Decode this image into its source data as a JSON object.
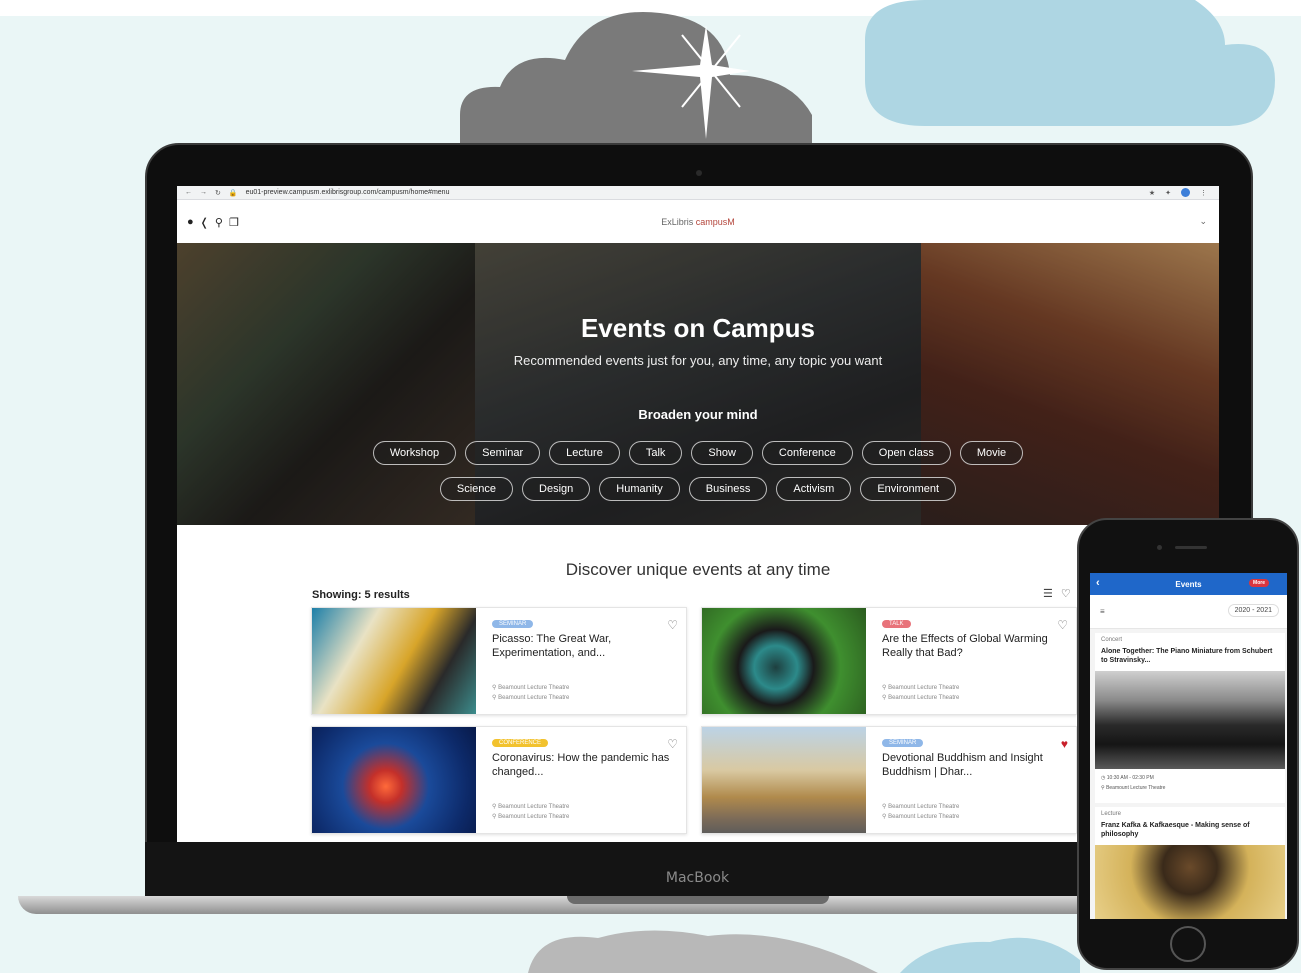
{
  "device": {
    "laptop_brand": "MacBook"
  },
  "browser": {
    "url": "eu01-preview.campusm.exlibrisgroup.com/campusm/home#menu"
  },
  "app": {
    "logo_prefix": "ExLibris",
    "logo_name": "campusM"
  },
  "hero": {
    "title": "Events on Campus",
    "subtitle": "Recommended events just for you, any time, any topic you want",
    "broaden": "Broaden your mind",
    "chips_row1": [
      "Workshop",
      "Seminar",
      "Lecture",
      "Talk",
      "Show",
      "Conference",
      "Open class",
      "Movie"
    ],
    "chips_row2": [
      "Science",
      "Design",
      "Humanity",
      "Business",
      "Activism",
      "Environment"
    ]
  },
  "discover": {
    "heading": "Discover unique events at any time",
    "showing": "Showing: 5 results"
  },
  "events": [
    {
      "badge": "Seminar",
      "badge_color": "#8fb7e8",
      "title": "Picasso: The Great War, Experimentation, and...",
      "loc1": "Beamount Lecture Theatre",
      "loc2": "Beamount Lecture Theatre",
      "favorited": false
    },
    {
      "badge": "Talk",
      "badge_color": "#e8737a",
      "title": "Are the Effects of Global Warming Really that Bad?",
      "loc1": "Beamount Lecture Theatre",
      "loc2": "Beamount Lecture Theatre",
      "favorited": false
    },
    {
      "badge": "Conference",
      "badge_color": "#f2c22e",
      "title": "Coronavirus: How the pandemic has changed...",
      "loc1": "Beamount Lecture Theatre",
      "loc2": "Beamount Lecture Theatre",
      "favorited": false
    },
    {
      "badge": "Seminar",
      "badge_color": "#8fb7e8",
      "title": "Devotional Buddhism and Insight Buddhism | Dhar...",
      "loc1": "Beamount Lecture Theatre",
      "loc2": "Beamount Lecture Theatre",
      "favorited": true
    }
  ],
  "phone": {
    "header": "Events",
    "more": "More",
    "year_range": "2020 - 2021",
    "items": [
      {
        "category": "Concert",
        "title": "Alone Together: The Piano Miniature from Schubert to Stravinsky...",
        "time": "10:30 AM - 02:30 PM",
        "location": "Beamount Lecture Theatre"
      },
      {
        "category": "Lecture",
        "title": "Franz Kafka & Kafkaesque - Making sense of philosophy"
      }
    ]
  },
  "colors": {
    "accent": "#1f67c9",
    "favorite": "#c8202b",
    "logo": "#b4463c"
  }
}
